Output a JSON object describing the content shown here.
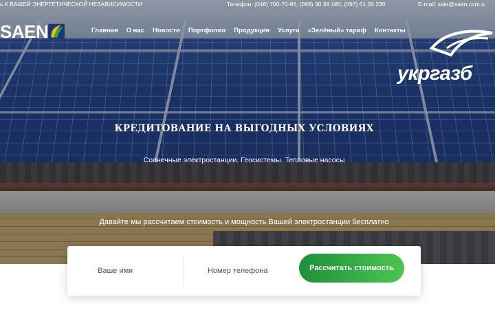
{
  "topbar": {
    "slogan": "ь К ВАШЕЙ ЭНЕРГЕТИЧЕСКОЙ НЕЗАВИСИМОСТИ",
    "phones": "Телефон: (048) 700-70-96, (099) 30 39 180, (097) 61 36 230",
    "email": "E-mail: sale@saen.com.u"
  },
  "logo": {
    "text": "SAEN",
    "colors": {
      "green": "#2fa84f",
      "yellow": "#f2c400"
    }
  },
  "nav": {
    "items": [
      {
        "label": "Главная"
      },
      {
        "label": "О нас"
      },
      {
        "label": "Новости"
      },
      {
        "label": "Портфолио"
      },
      {
        "label": "Продукция"
      },
      {
        "label": "Услуги"
      },
      {
        "label": "«Зелёный» тариф"
      },
      {
        "label": "Контакты"
      }
    ]
  },
  "partner": {
    "text": "укргазб"
  },
  "hero": {
    "headline": "КРЕДИТОВАНИЕ НА ВЫГОДНЫХ УСЛОВИЯХ",
    "subline": "Солнечные электростанции. Геосистемы. Тепловые насосы",
    "calc_text": "Давайте мы рассчитаем стоимость и мощность Вашей электростанции бесплатно"
  },
  "form": {
    "name_placeholder": "Ваше имя",
    "phone_placeholder": "Номер телефона",
    "submit_label": "Рассчитать стоимость"
  },
  "colors": {
    "cta_start": "#1e8f3a",
    "cta_end": "#4cc552",
    "panel_blue": "#1f3d84"
  }
}
